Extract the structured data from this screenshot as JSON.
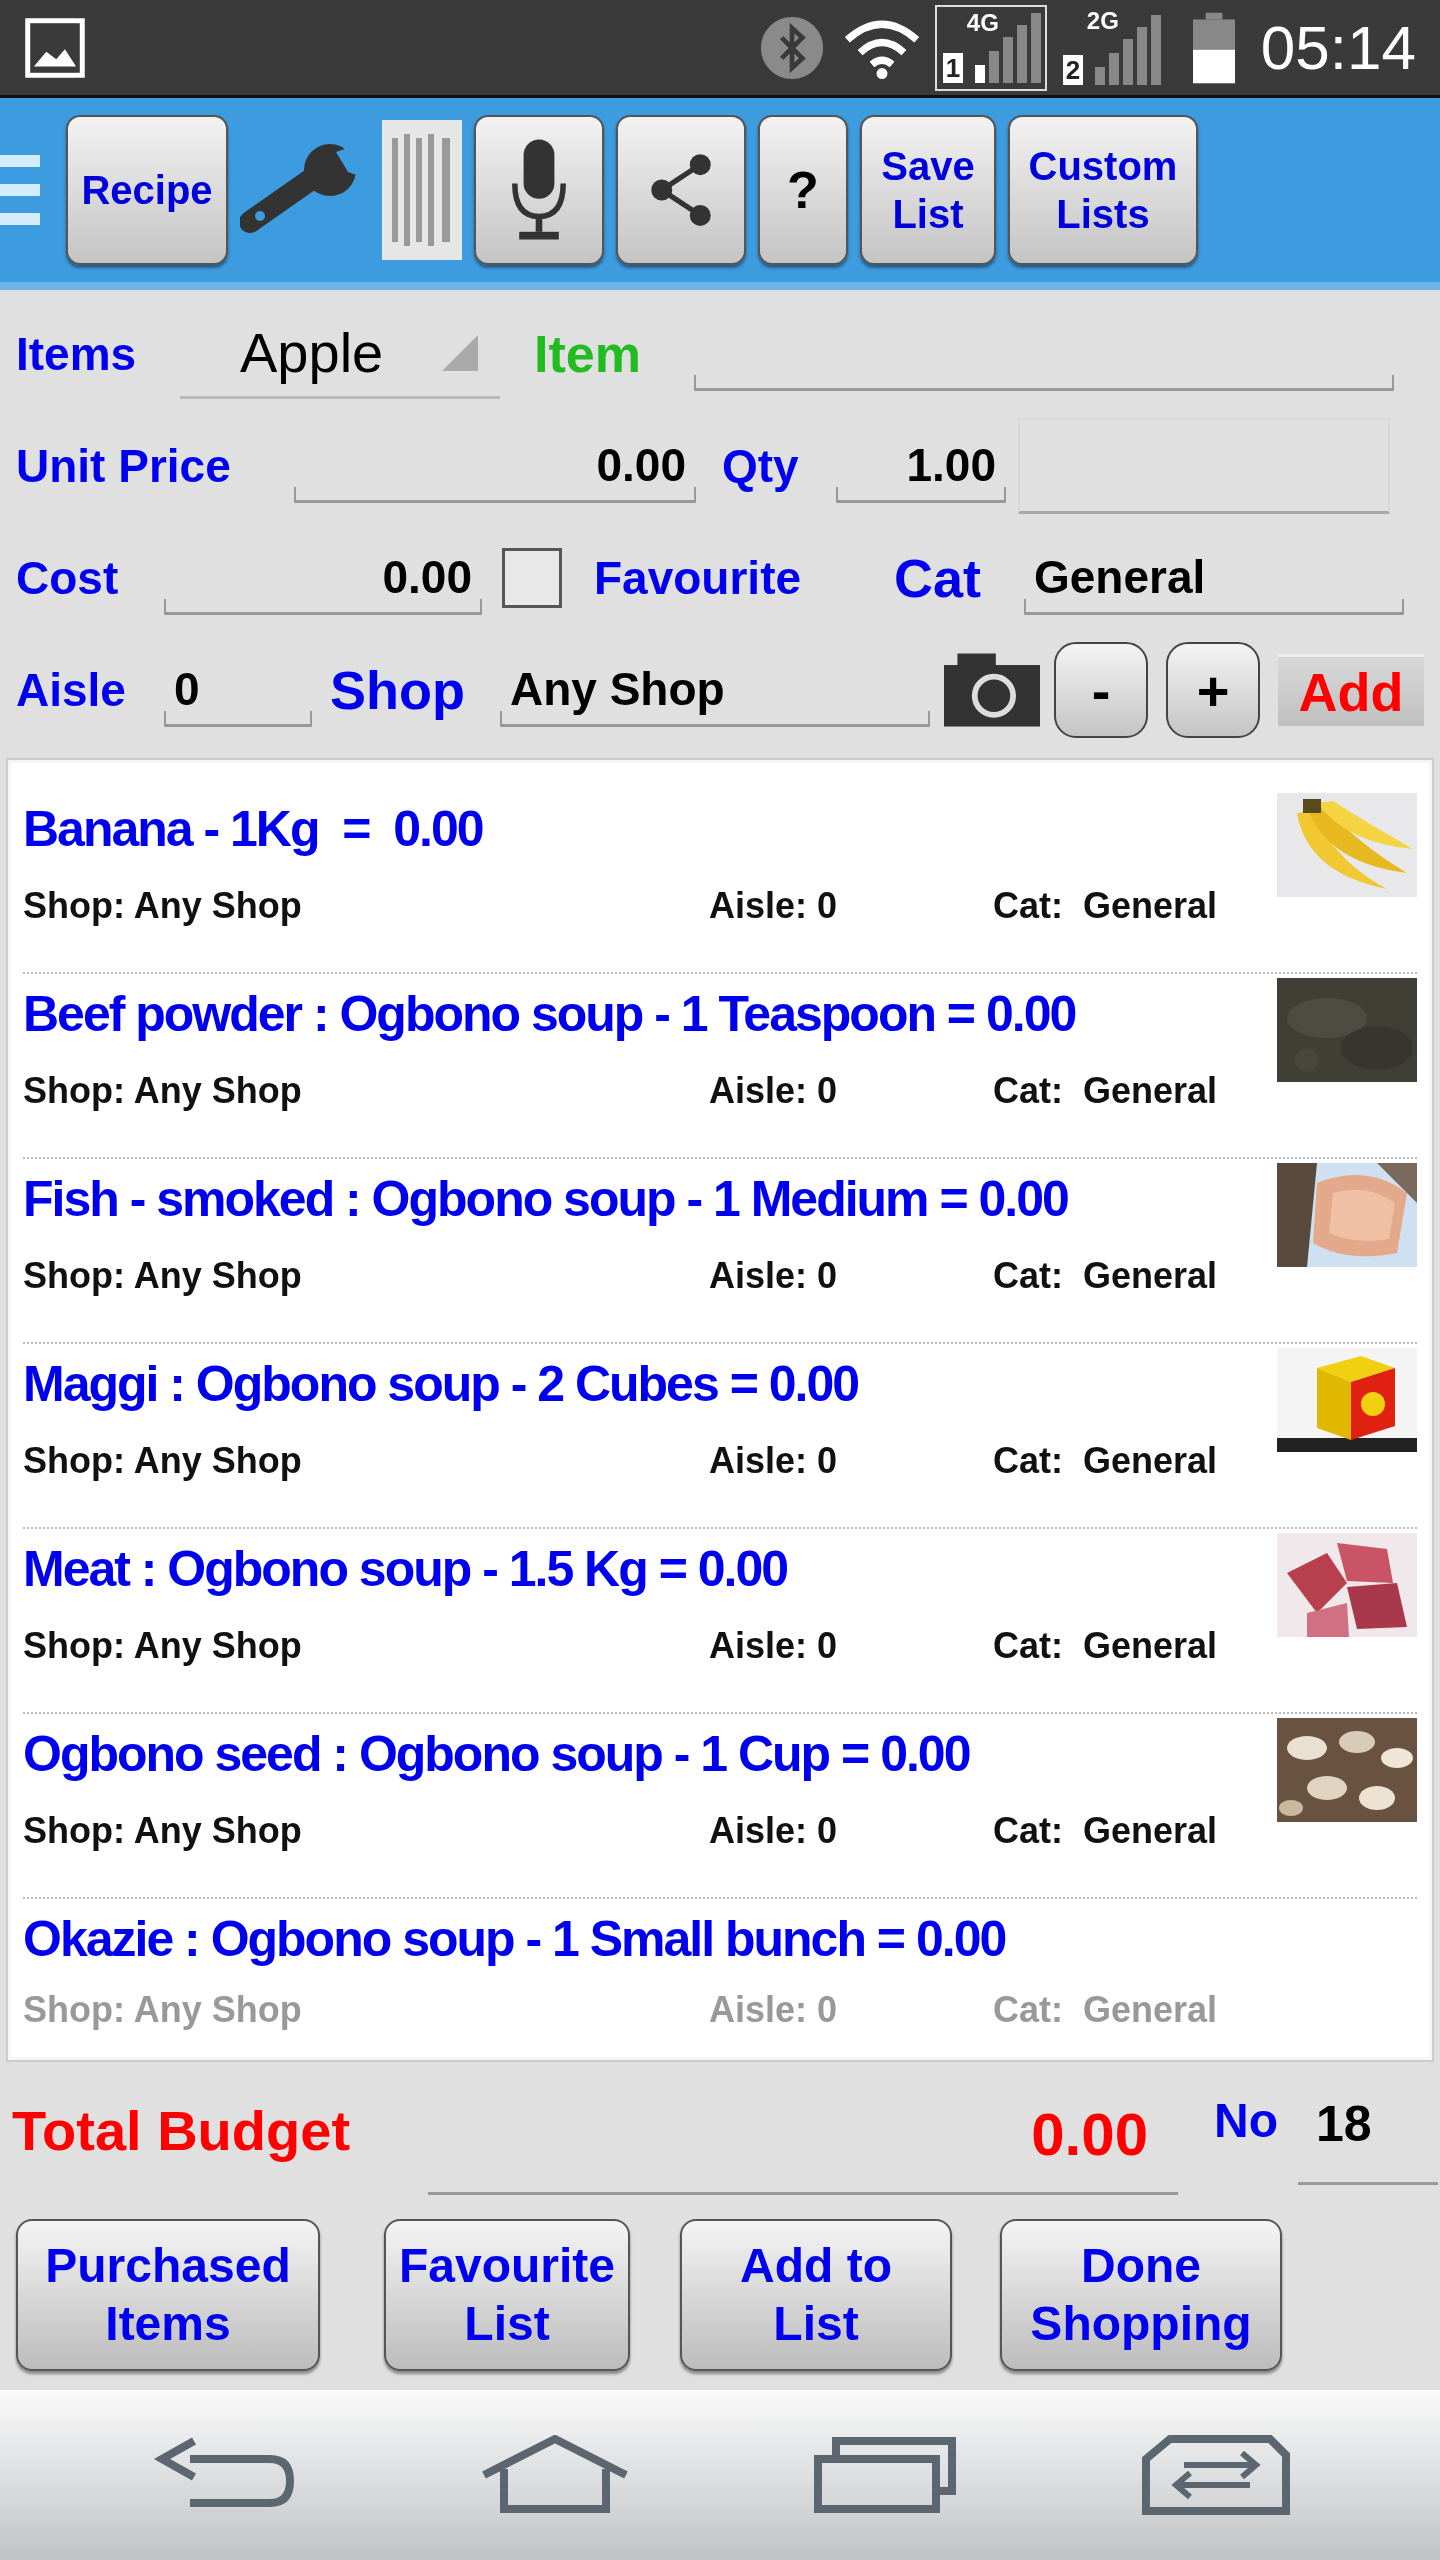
{
  "status_bar": {
    "network_1": "4G",
    "sim_1": "1",
    "network_2": "2G",
    "sim_2": "2",
    "time": "05:14"
  },
  "toolbar": {
    "recipe": "Recipe",
    "help": "?",
    "save_list": "Save List",
    "custom_lists": "Custom Lists"
  },
  "form": {
    "items_label": "Items",
    "items_value": "Apple",
    "item_label": "Item",
    "unit_price_label": "Unit Price",
    "unit_price": "0.00",
    "qty_label": "Qty",
    "qty": "1.00",
    "cost_label": "Cost",
    "cost": "0.00",
    "favourite_checked": false,
    "favourite_label": "Favourite",
    "cat_label": "Cat",
    "cat": "General",
    "aisle_label": "Aisle",
    "aisle": "0",
    "shop_label": "Shop",
    "shop": "Any Shop",
    "minus": "-",
    "plus": "+",
    "add": "Add"
  },
  "items": [
    {
      "title": "Banana - 1Kg  =  0.00",
      "shop": "Shop: Any Shop",
      "aisle": "Aisle: 0",
      "cat": "Cat:  General",
      "thumbnail": true
    },
    {
      "title": "Beef powder : Ogbono soup - 1 Teaspoon = 0.00",
      "shop": "Shop: Any Shop",
      "aisle": "Aisle: 0",
      "cat": "Cat:  General",
      "thumbnail": true
    },
    {
      "title": "Fish - smoked : Ogbono soup - 1 Medium = 0.00",
      "shop": "Shop: Any Shop",
      "aisle": "Aisle: 0",
      "cat": "Cat:  General",
      "thumbnail": true
    },
    {
      "title": "Maggi : Ogbono soup - 2 Cubes = 0.00",
      "shop": "Shop: Any Shop",
      "aisle": "Aisle: 0",
      "cat": "Cat:  General",
      "thumbnail": true
    },
    {
      "title": "Meat : Ogbono soup - 1.5 Kg = 0.00",
      "shop": "Shop: Any Shop",
      "aisle": "Aisle: 0",
      "cat": "Cat:  General",
      "thumbnail": true
    },
    {
      "title": "Ogbono seed : Ogbono soup - 1 Cup = 0.00",
      "shop": "Shop: Any Shop",
      "aisle": "Aisle: 0",
      "cat": "Cat:  General",
      "thumbnail": true
    },
    {
      "title": "Okazie : Ogbono soup - 1 Small bunch = 0.00",
      "shop": "Shop: Any Shop",
      "aisle": "Aisle: 0",
      "cat": "Cat:  General",
      "thumbnail": false
    }
  ],
  "total": {
    "label": "Total Budget",
    "value": "0.00",
    "no_label": "No",
    "no": "18"
  },
  "buttons": [
    "Purchased Items",
    "Favourite List",
    "Add to List",
    "Done Shopping"
  ]
}
